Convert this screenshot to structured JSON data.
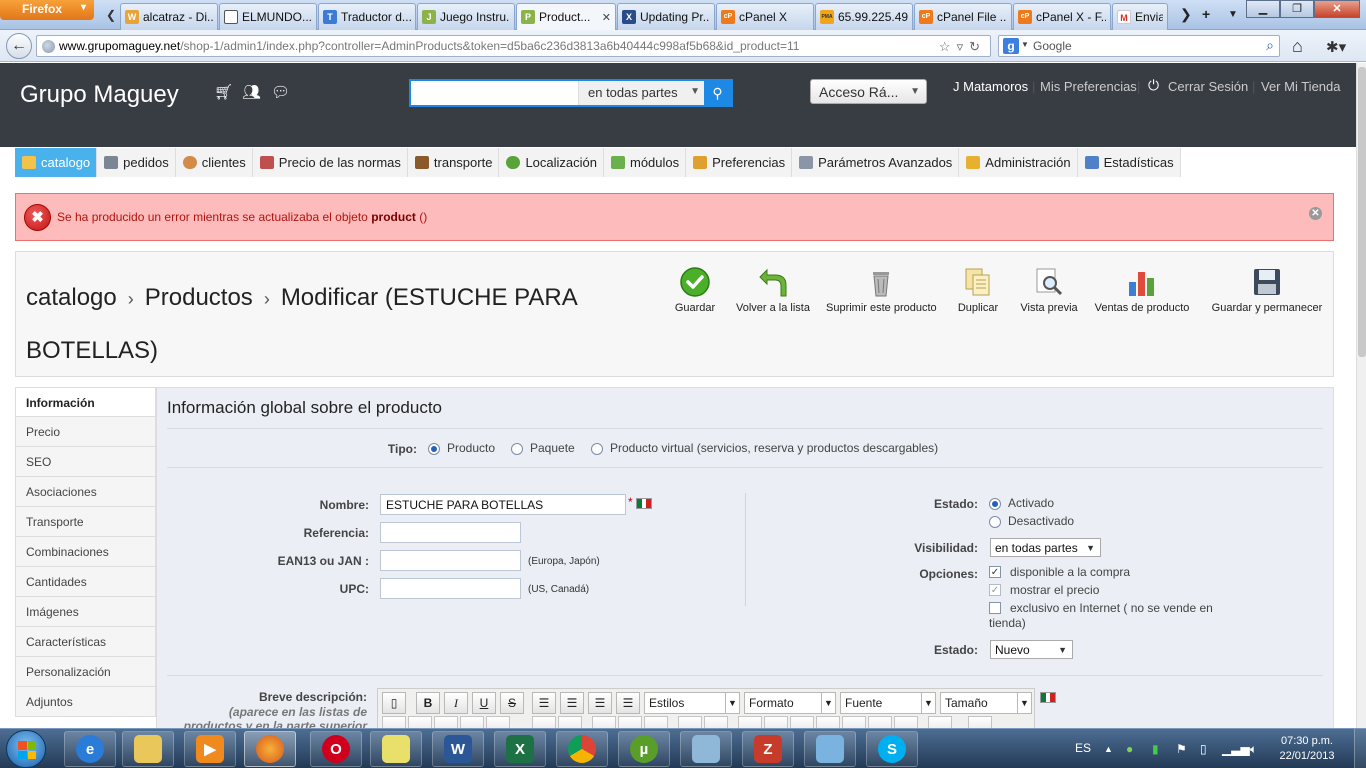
{
  "browser": {
    "app_button": "Firefox",
    "tabs": [
      {
        "title": "alcatraz - Di...",
        "fav": "W",
        "fav_color": "#e8a33a"
      },
      {
        "title": "ELMUNDO....",
        "fav": "",
        "fav_color": "#ffffff"
      },
      {
        "title": "Traductor d...",
        "fav": "T",
        "fav_color": "#3b7bd6"
      },
      {
        "title": "Juego Instru...",
        "fav": "J",
        "fav_color": "#8cb34a"
      },
      {
        "title": "Product...",
        "fav": "P",
        "fav_color": "#8cb34a"
      },
      {
        "title": "Updating Pr...",
        "fav": "X",
        "fav_color": "#2a4b8a"
      },
      {
        "title": "cPanel X",
        "fav": "cP",
        "fav_color": "#f07a1b"
      },
      {
        "title": "65.99.225.49...",
        "fav": "PMA",
        "fav_color": "#f0a51b"
      },
      {
        "title": "cPanel File ...",
        "fav": "cP",
        "fav_color": "#f07a1b"
      },
      {
        "title": "cPanel X - F...",
        "fav": "cP",
        "fav_color": "#f07a1b"
      },
      {
        "title": "Envia",
        "fav": "M",
        "fav_color": "#d93025"
      }
    ],
    "url_domain": "www.grupomaguey.net",
    "url_rest": "/shop-1/admin1/index.php?controller=AdminProducts&token=d5ba6c236d3813a6b40444c998af5b68&id_product=11",
    "search_engine": "Google",
    "search_placeholder": "Google"
  },
  "header": {
    "shop_name": "Grupo Maguey",
    "search_scope": "en todas partes",
    "quick_access": "Acceso Rá...",
    "user": "J Matamoros",
    "preferences": "Mis Preferencias",
    "logout": "Cerrar Sesión",
    "view_store": "Ver Mi Tienda"
  },
  "menu": [
    {
      "label": "catalogo",
      "icon_color": "#f3c24a"
    },
    {
      "label": "pedidos",
      "icon_color": "#7a8694"
    },
    {
      "label": "clientes",
      "icon_color": "#d38b4a"
    },
    {
      "label": "Precio de las normas",
      "icon_color": "#c0504d"
    },
    {
      "label": "transporte",
      "icon_color": "#8b5a2b"
    },
    {
      "label": "Localización",
      "icon_color": "#5aa33a"
    },
    {
      "label": "módulos",
      "icon_color": "#6ab04c"
    },
    {
      "label": "Preferencias",
      "icon_color": "#e0a030"
    },
    {
      "label": "Parámetros Avanzados",
      "icon_color": "#8a96a6"
    },
    {
      "label": "Administración",
      "icon_color": "#e8b030"
    },
    {
      "label": "Estadísticas",
      "icon_color": "#5080c8"
    }
  ],
  "alert": {
    "prefix": "Se ha producido un error mientras se actualizaba el objeto",
    "object": "product",
    "suffix": "()"
  },
  "breadcrumb": {
    "part1": "catalogo",
    "part2": "Productos",
    "part3": "Modificar (ESTUCHE PARA BOTELLAS)"
  },
  "toolbar": {
    "save": "Guardar",
    "back": "Volver a la lista",
    "delete": "Suprimir este producto",
    "duplicate": "Duplicar",
    "preview": "Vista previa",
    "sales": "Ventas de producto",
    "save_stay": "Guardar y permanecer"
  },
  "left_tabs": [
    "Información",
    "Precio",
    "SEO",
    "Asociaciones",
    "Transporte",
    "Combinaciones",
    "Cantidades",
    "Imágenes",
    "Características",
    "Personalización",
    "Adjuntos"
  ],
  "form": {
    "title": "Información global sobre el producto",
    "type_label": "Tipo:",
    "type_options": [
      "Producto",
      "Paquete",
      "Producto virtual (servicios, reserva y productos descargables)"
    ],
    "name_label": "Nombre:",
    "name_value": "ESTUCHE PARA BOTELLAS",
    "reference_label": "Referencia:",
    "reference_value": "",
    "ean_label": "EAN13 ou JAN :",
    "ean_value": "",
    "ean_hint": "(Europa, Japón)",
    "upc_label": "UPC:",
    "upc_value": "",
    "upc_hint": "(US, Canadá)",
    "status_label": "Estado:",
    "status_on": "Activado",
    "status_off": "Desactivado",
    "visibility_label": "Visibilidad:",
    "visibility_value": "en todas partes",
    "options_label": "Opciones:",
    "option_available": "disponible a la compra",
    "option_show_price": "mostrar el precio",
    "option_online": "exclusivo en Internet ( no se vende en",
    "option_online_2": "tienda)",
    "condition_label": "Estado:",
    "condition_value": "Nuevo",
    "short_desc_label": "Breve descripción:",
    "short_desc_hint": "(aparece en las listas de productos y en la parte superior de la página del",
    "editor_styles": "Estilos",
    "editor_format": "Formato",
    "editor_font": "Fuente",
    "editor_size": "Tamaño"
  },
  "taskbar": {
    "lang": "ES",
    "time": "07:30 p.m.",
    "date": "22/01/2013"
  },
  "colors": {
    "header_bg": "#383c43",
    "menu_active": "#49b2ec",
    "alert_bg": "#fdbbbb",
    "accent": "#1e88e5"
  }
}
